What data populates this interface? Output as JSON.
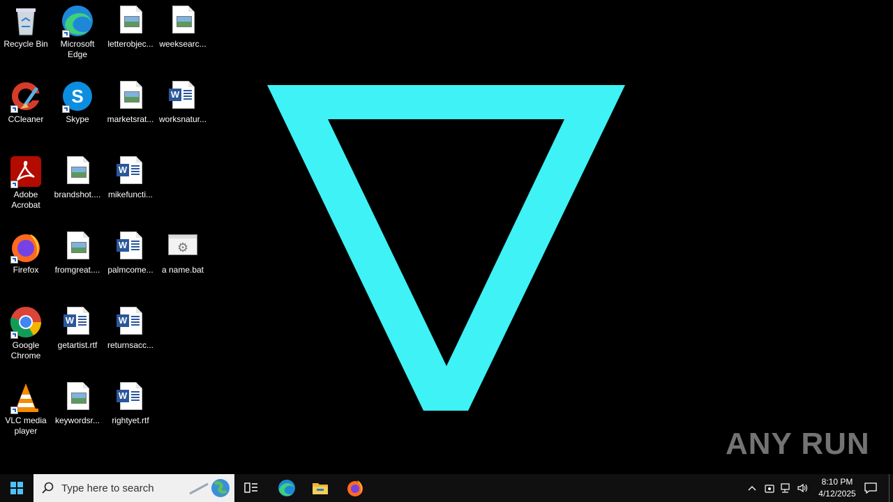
{
  "desktop": {
    "icons": [
      {
        "label": "Recycle Bin"
      },
      {
        "label": "Microsoft Edge"
      },
      {
        "label": "letterobjec..."
      },
      {
        "label": "weeksearc..."
      },
      {
        "label": "CCleaner"
      },
      {
        "label": "Skype"
      },
      {
        "label": "marketsrat..."
      },
      {
        "label": "worksnatur..."
      },
      {
        "label": "Adobe Acrobat"
      },
      {
        "label": "brandshot...."
      },
      {
        "label": "mikefuncti..."
      },
      {
        "label": "Firefox"
      },
      {
        "label": "fromgreat...."
      },
      {
        "label": "palmcome..."
      },
      {
        "label": "a name.bat"
      },
      {
        "label": "Google Chrome"
      },
      {
        "label": "getartist.rtf"
      },
      {
        "label": "returnsacc..."
      },
      {
        "label": "VLC media player"
      },
      {
        "label": "keywordsr..."
      },
      {
        "label": "rightyet.rtf"
      }
    ],
    "wallpaper_color": "#3ef2f5",
    "watermark": "ANY RUN"
  },
  "taskbar": {
    "search_placeholder": "Type here to search",
    "time": "8:10 PM",
    "date": "4/12/2025",
    "pinned": [
      "task-view-icon",
      "edge-icon",
      "file-explorer-icon",
      "firefox-icon"
    ]
  }
}
